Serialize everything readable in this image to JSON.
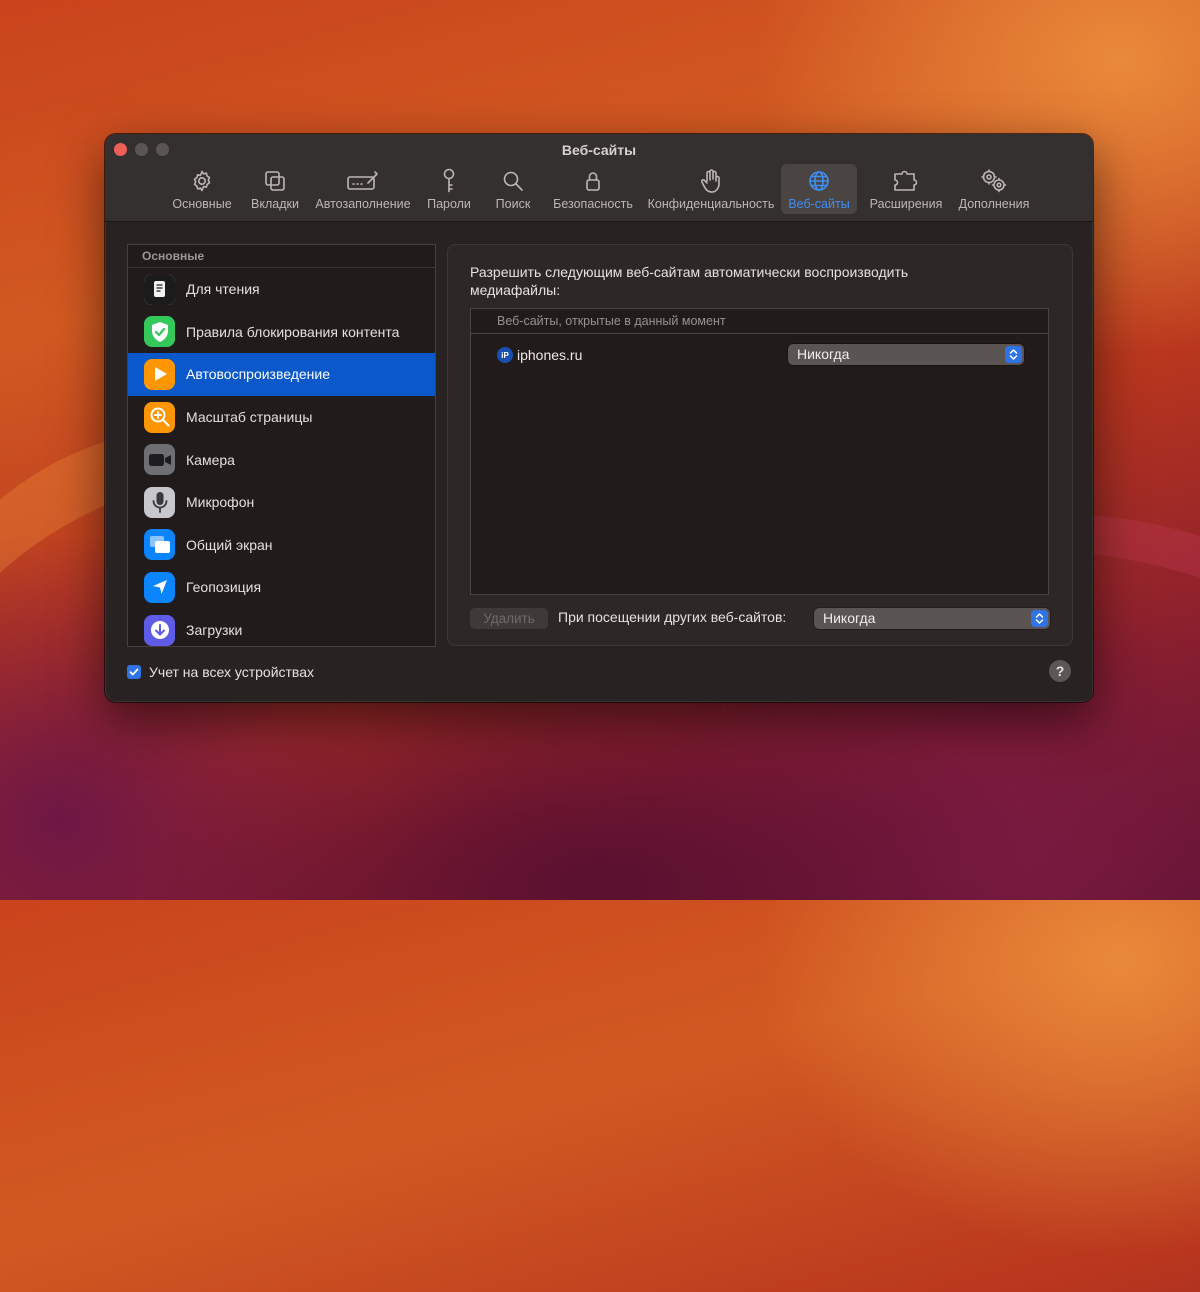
{
  "window": {
    "title": "Веб-сайты"
  },
  "toolbar": {
    "items": [
      {
        "label": "Основные",
        "icon": "gear-icon"
      },
      {
        "label": "Вкладки",
        "icon": "tabs-icon"
      },
      {
        "label": "Автозаполнение",
        "icon": "autofill-icon"
      },
      {
        "label": "Пароли",
        "icon": "key-icon"
      },
      {
        "label": "Поиск",
        "icon": "search-icon"
      },
      {
        "label": "Безопасность",
        "icon": "lock-icon"
      },
      {
        "label": "Конфиденциальность",
        "icon": "hand-icon"
      },
      {
        "label": "Веб-сайты",
        "icon": "globe-icon",
        "active": true
      },
      {
        "label": "Расширения",
        "icon": "puzzle-icon"
      },
      {
        "label": "Дополнения",
        "icon": "gears-icon"
      }
    ]
  },
  "sidebar": {
    "header": "Основные",
    "items": [
      {
        "label": "Для чтения",
        "icon": "reader-icon",
        "color": "#1c1c1c"
      },
      {
        "label": "Правила блокирования контента",
        "icon": "shield-check-icon",
        "color": "#34c759"
      },
      {
        "label": "Автовоспроизведение",
        "icon": "play-icon",
        "color": "#ff9500",
        "selected": true
      },
      {
        "label": "Масштаб страницы",
        "icon": "zoom-icon",
        "color": "#ff9500"
      },
      {
        "label": "Камера",
        "icon": "camera-icon",
        "color": "#6e6e73"
      },
      {
        "label": "Микрофон",
        "icon": "microphone-icon",
        "color": "#8e8e93"
      },
      {
        "label": "Общий экран",
        "icon": "screen-share-icon",
        "color": "#0a84ff"
      },
      {
        "label": "Геопозиция",
        "icon": "location-icon",
        "color": "#0a84ff"
      },
      {
        "label": "Загрузки",
        "icon": "download-icon",
        "color": "#5e5ce6"
      }
    ]
  },
  "content": {
    "intro": "Разрешить следующим веб-сайтам автоматически воспроизводить медиафайлы:",
    "table_header": "Веб-сайты, открытые в данный момент",
    "sites": [
      {
        "icon_text": "iP",
        "name": "iphones.ru",
        "setting": "Никогда"
      }
    ],
    "delete_label": "Удалить",
    "other_sites_label": "При посещении других веб-сайтов:",
    "other_sites_value": "Никогда"
  },
  "footer": {
    "sync_label": "Учет на всех устройствах",
    "sync_checked": true,
    "help_label": "?"
  },
  "colors": {
    "accent": "#2f74e6",
    "selection": "#0a58c9"
  }
}
